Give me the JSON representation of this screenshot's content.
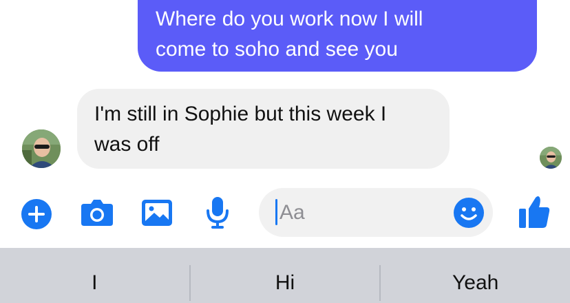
{
  "messages": {
    "outgoing": {
      "line1": "Where do you work now I will",
      "line2": "come to soho and see you"
    },
    "incoming": {
      "line1": "I'm still in Sophie but this week I",
      "line2": "was off"
    }
  },
  "composer": {
    "placeholder": "Aa",
    "icons": [
      "plus-icon",
      "camera-icon",
      "photo-icon",
      "mic-icon",
      "smiley-icon",
      "like-icon"
    ],
    "accent": "#1877f2"
  },
  "suggestions": [
    "I",
    "Hi",
    "Yeah"
  ],
  "colors": {
    "outgoing_bubble": "#5b5cf8",
    "incoming_bubble": "#f0f0f0",
    "keyboard_bar": "#d1d3d9"
  }
}
